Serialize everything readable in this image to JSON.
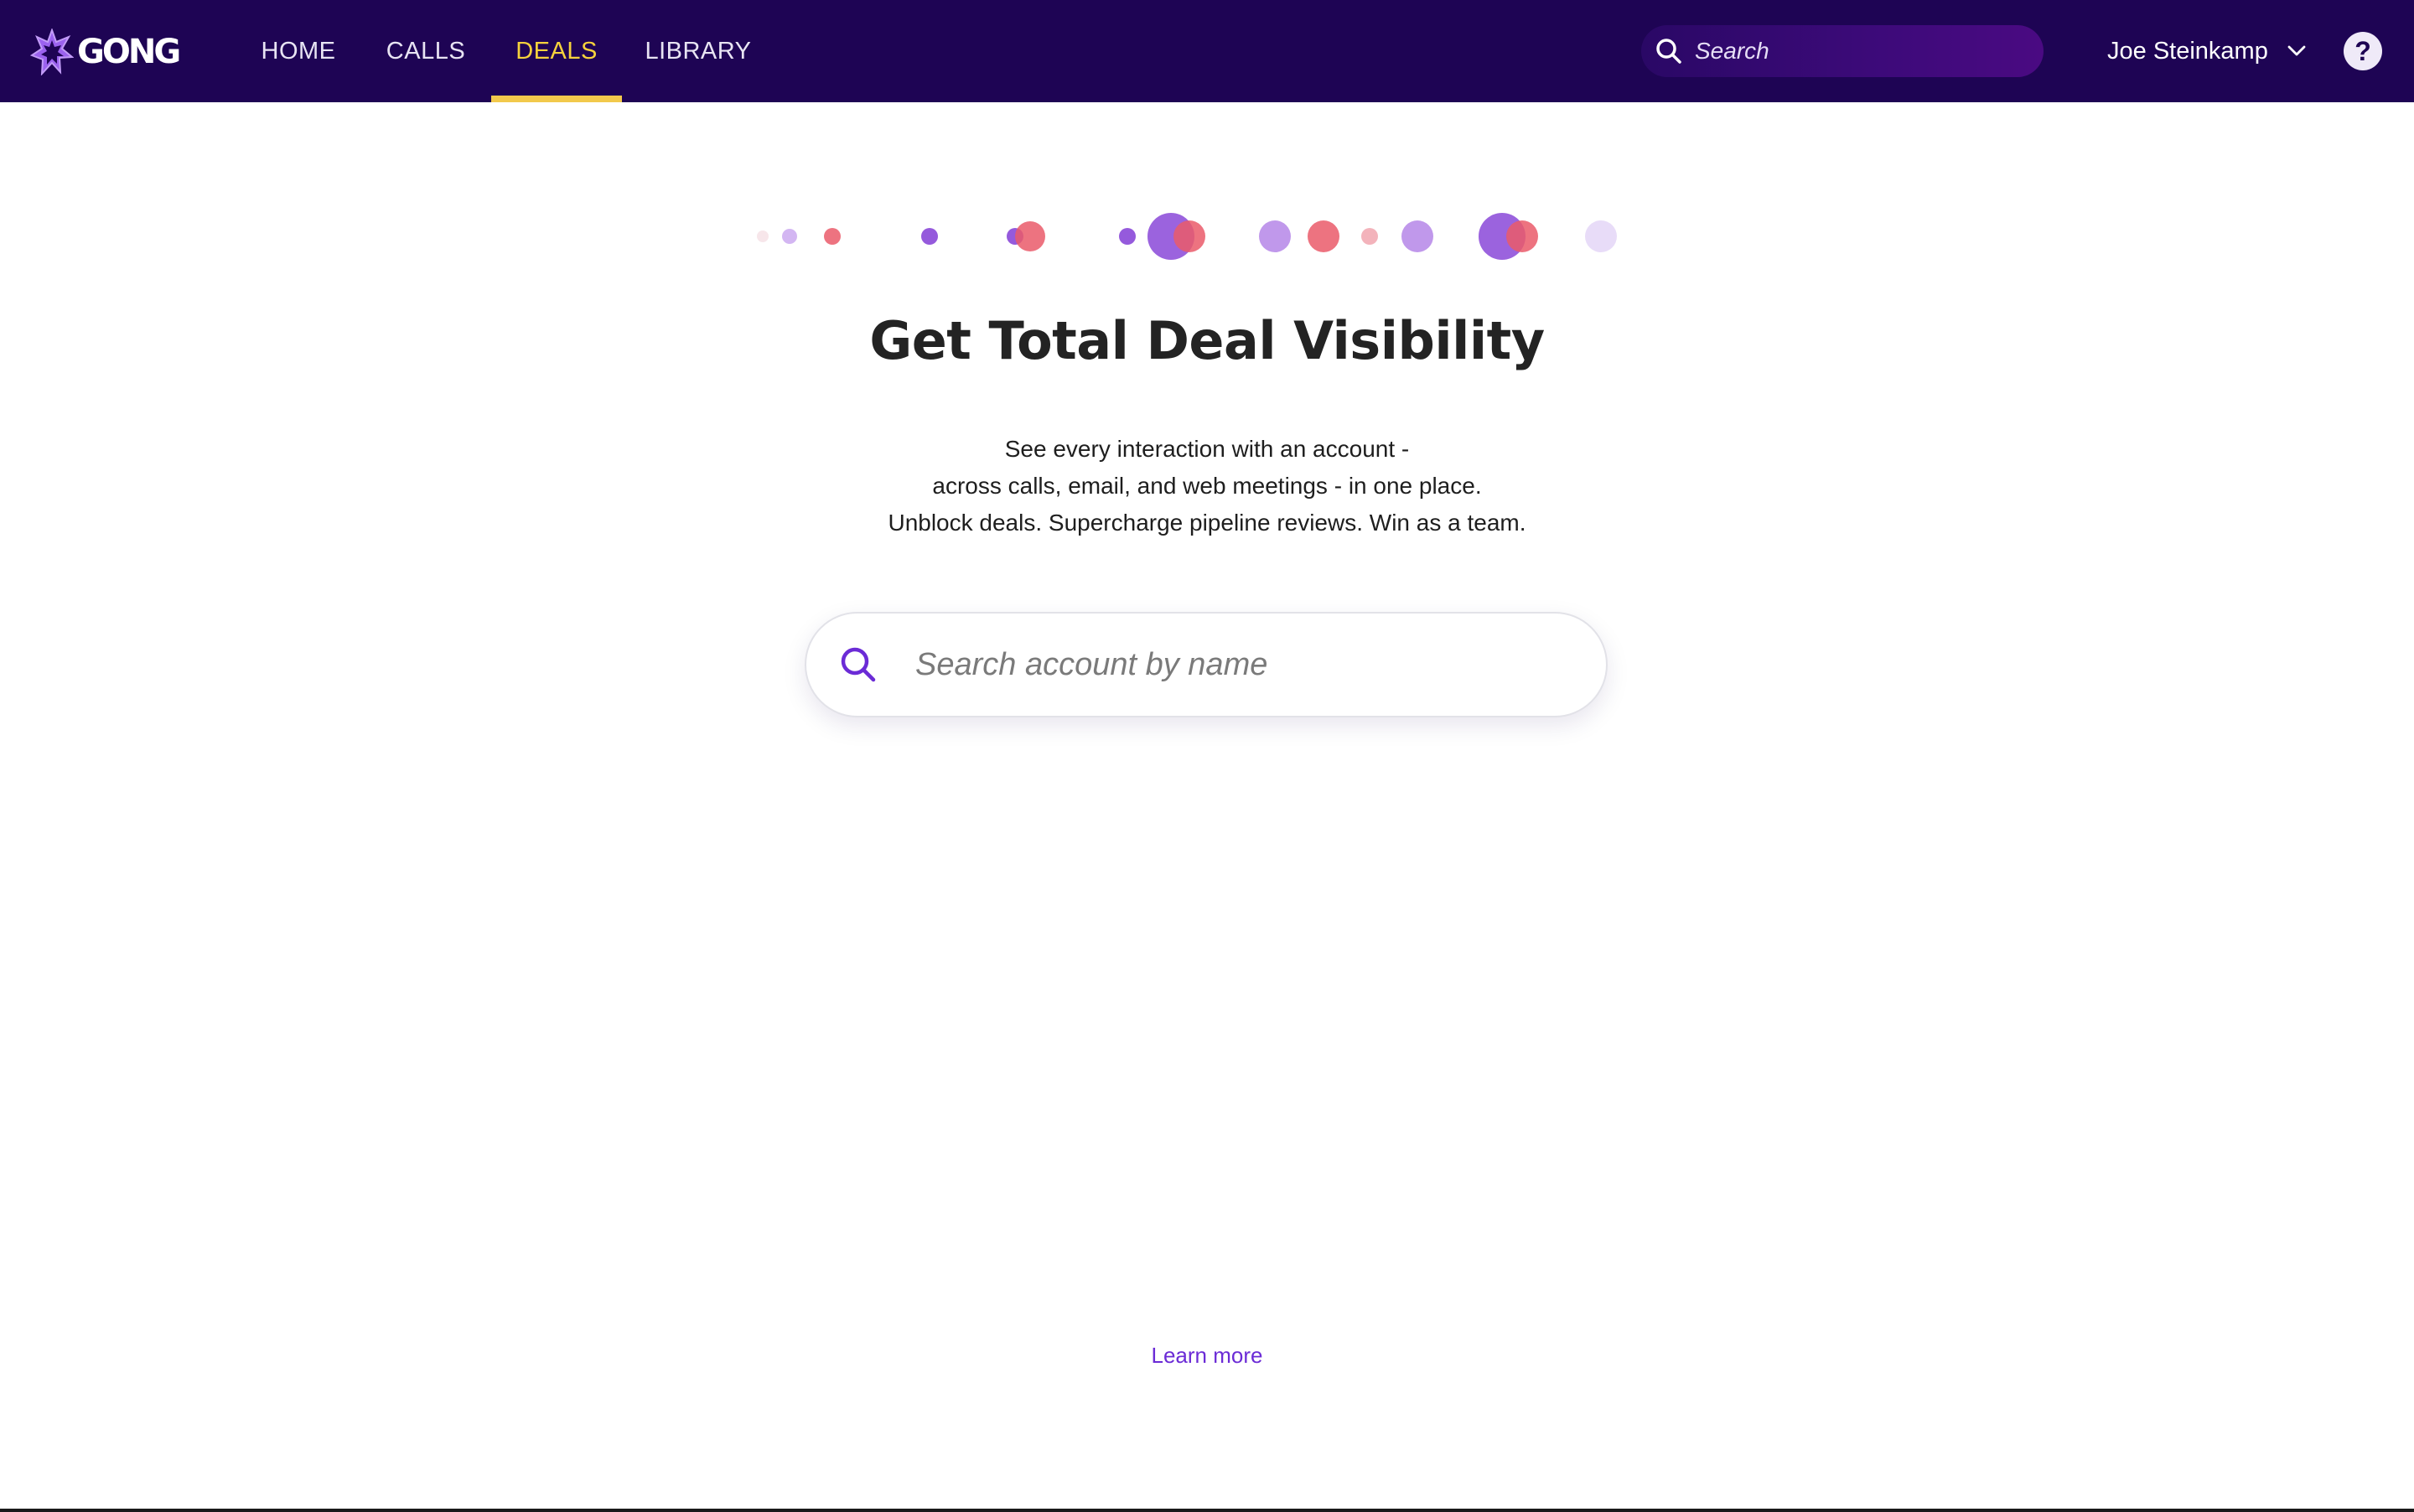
{
  "app": {
    "name": "GONG"
  },
  "nav": {
    "tabs": [
      {
        "label": "HOME",
        "active": false
      },
      {
        "label": "CALLS",
        "active": false
      },
      {
        "label": "DEALS",
        "active": true
      },
      {
        "label": "LIBRARY",
        "active": false
      }
    ],
    "search_placeholder": "Search",
    "user_name": "Joe Steinkamp",
    "help_label": "?"
  },
  "hero": {
    "title": "Get Total Deal Visibility",
    "lines": [
      "See every interaction with an account -",
      "across calls, email, and web meetings - in one place.",
      "Unblock deals. Supercharge pipeline reviews. Win as a team."
    ],
    "search_placeholder": "Search account by name",
    "learn_more": "Learn more"
  },
  "colors": {
    "nav_bg": "#1e0454",
    "active_tab": "#f6d23c",
    "accent_purple": "#6b2bd6",
    "dot_purple": "#8a48d8",
    "dot_red": "#ea5a6a"
  },
  "icons": [
    "gong-logo-icon",
    "search-icon",
    "chevron-down-icon",
    "help-icon"
  ]
}
